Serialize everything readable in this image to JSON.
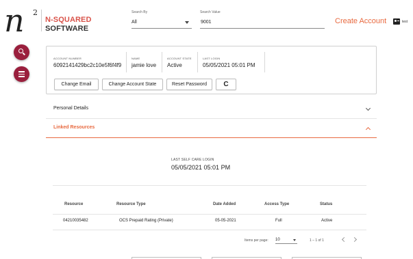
{
  "brand": {
    "logo_letter": "n",
    "logo_superscript": "2",
    "line1": "N-SQUARED",
    "line2": "SOFTWARE"
  },
  "search": {
    "search_by_label": "Search By",
    "search_by_value": "All",
    "search_value_label": "Search Value",
    "search_value": "9001"
  },
  "header": {
    "create_account": "Create Account",
    "user_name": "test"
  },
  "account": {
    "fields": [
      {
        "label": "ACCOUNT NUMBER",
        "value": "6092141429bc2c10e5f6f4f9"
      },
      {
        "label": "NAME",
        "value": "jamie love"
      },
      {
        "label": "ACCOUNT STATE",
        "value": "Active"
      },
      {
        "label": "LAST LOGIN",
        "value": "05/05/2021 05:01 PM"
      }
    ],
    "buttons": {
      "change_email": "Change Email",
      "change_state": "Change Account State",
      "reset_password": "Reset Password",
      "refresh_icon": "C"
    }
  },
  "panels": {
    "personal_details": "Personal Details",
    "linked_resources": "Linked Resources"
  },
  "self_care": {
    "label": "LAST SELF CARE LOGIN",
    "value": "05/05/2021 05:01 PM"
  },
  "table": {
    "headers": [
      "Resource",
      "Resource Type",
      "Date Added",
      "Access Type",
      "Status"
    ],
    "rows": [
      [
        "04210035482",
        "OCS Prepaid Rating (Private)",
        "05-05-2021",
        "Full",
        "Active"
      ]
    ]
  },
  "pager": {
    "items_per_page_label": "Items per page:",
    "items_per_page": "10",
    "range": "1 – 1 of 1"
  },
  "colors": {
    "accent": "#e8693f",
    "brand_red": "#d9534a",
    "fab": "#9a1f3d"
  },
  "icons": {
    "search": "search-icon",
    "menu": "menu-icon",
    "user": "account-box-icon",
    "refresh": "refresh-icon"
  }
}
